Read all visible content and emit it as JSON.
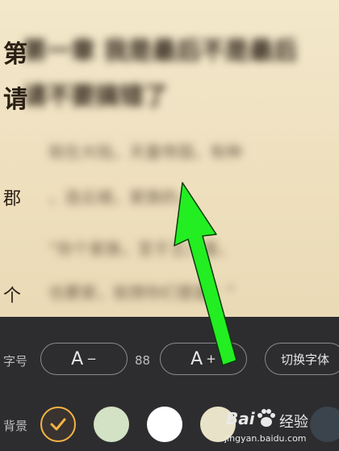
{
  "reader": {
    "edge_chars": [
      "第",
      "请",
      "郡",
      "个"
    ],
    "blurred_title_line1": "第一章 我是最后不是最后",
    "blurred_title_line2": "请不要搞错了",
    "blurred_para": [
      "就在大陆，天童帝国，有种",
      "，连云城，家族的，",
      "“你个家族，至于王八蛋，",
      "也要家，就想你们里面！”"
    ]
  },
  "settings": {
    "font_size_label": "字号",
    "decrease_symbol": "A",
    "decrease_suffix": "−",
    "font_size_value": "88",
    "increase_symbol": "A",
    "increase_suffix": "+",
    "switch_font_label": "切换字体",
    "background_label": "背景",
    "background_swatches": [
      {
        "color": "#3a3330",
        "selected": true
      },
      {
        "color": "#d3e2c4",
        "selected": false
      },
      {
        "color": "#ffffff",
        "selected": false
      },
      {
        "color": "#e8e3c8",
        "selected": false
      }
    ]
  },
  "watermark": {
    "brand": "Bai",
    "brand_suffix": "经验",
    "url": "jingyan.baidu.com"
  },
  "annotation_arrow_color": "#22ee22",
  "accent_color": "#f4b443"
}
